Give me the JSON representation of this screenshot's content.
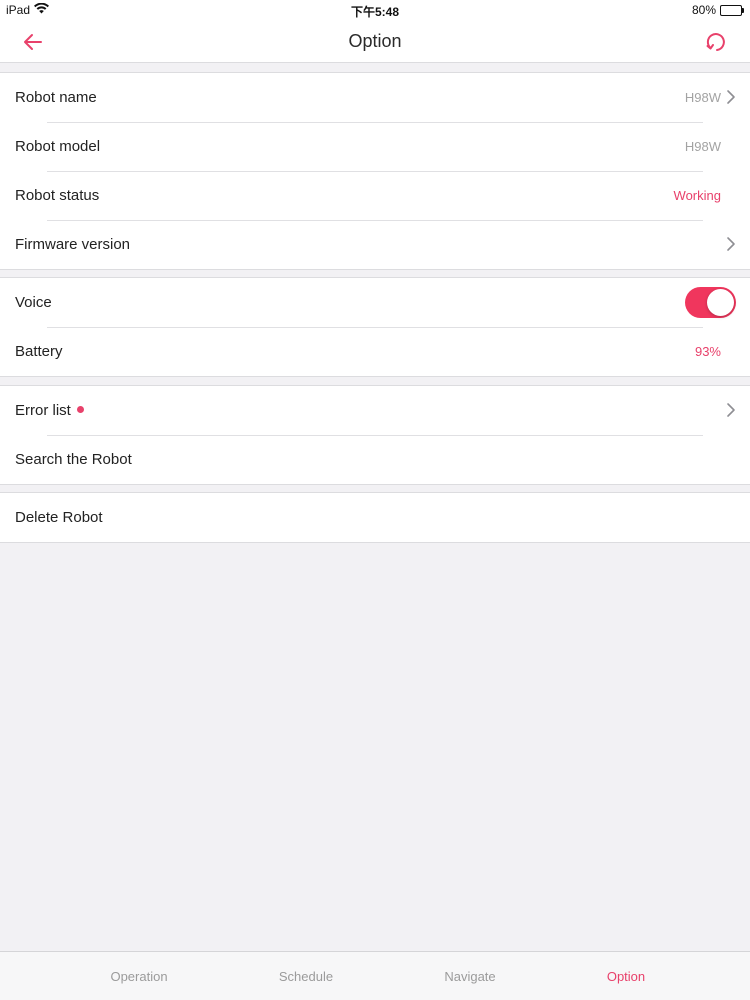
{
  "status_bar": {
    "device": "iPad",
    "time": "下午5:48",
    "battery": "80%",
    "battery_level": 0.8
  },
  "navbar": {
    "title": "Option",
    "back_icon": "arrow-left-icon",
    "refresh_icon": "refresh-icon"
  },
  "groups": {
    "info": {
      "robot_name": {
        "label": "Robot name",
        "value": "H98W"
      },
      "robot_model": {
        "label": "Robot model",
        "value": "H98W"
      },
      "robot_status": {
        "label": "Robot status",
        "value": "Working"
      },
      "firmware": {
        "label": "Firmware version"
      }
    },
    "settings": {
      "voice": {
        "label": "Voice",
        "enabled": true
      },
      "battery": {
        "label": "Battery",
        "value": "93%"
      }
    },
    "support": {
      "error_list": {
        "label": "Error list",
        "has_alert": true
      },
      "search_robot": {
        "label": "Search the Robot"
      }
    },
    "danger": {
      "delete_robot": {
        "label": "Delete Robot"
      }
    }
  },
  "tabs": {
    "operation": "Operation",
    "schedule": "Schedule",
    "navigate": "Navigate",
    "option": "Option",
    "active": "Option"
  },
  "colors": {
    "accent": "#e8416b",
    "toggle_on": "#f0365d",
    "background": "#f2f1f4",
    "secondary_text": "#a3a3a3"
  }
}
